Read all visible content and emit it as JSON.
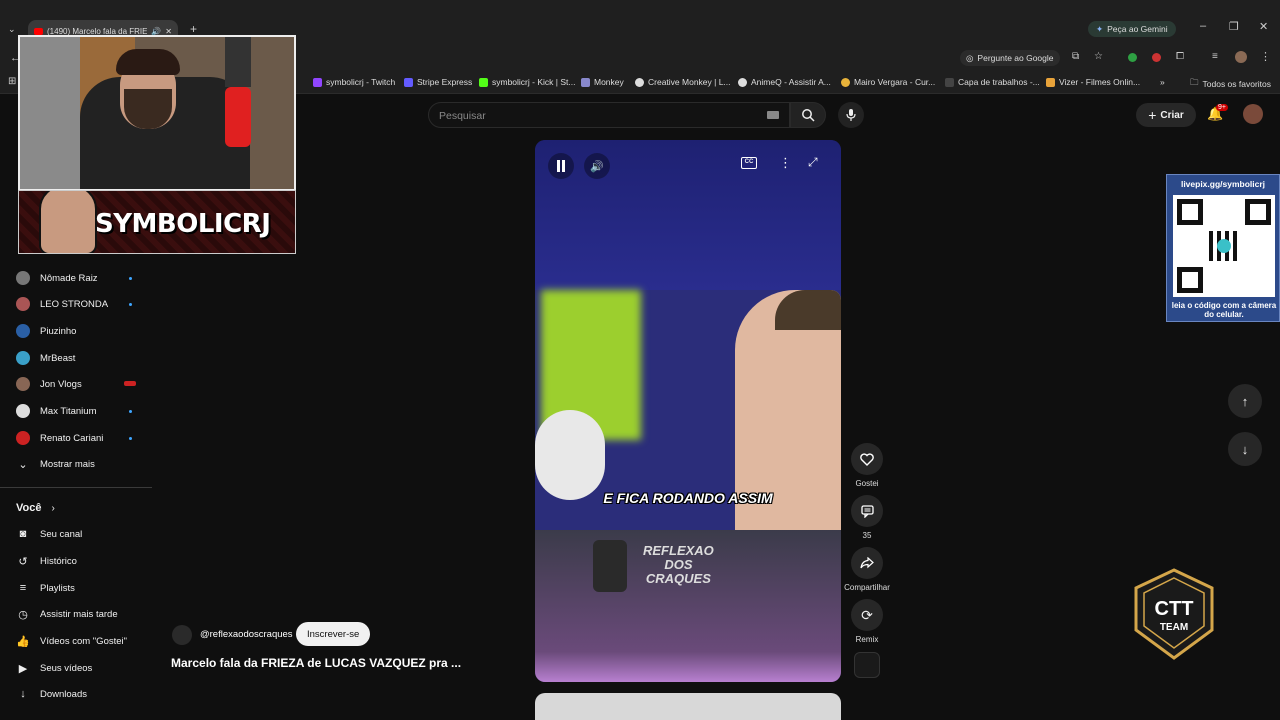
{
  "browser": {
    "tab_title": "(1490) Marcelo fala da FRIE",
    "gemini_label": "Peça ao Gemini",
    "ask_google_label": "Pergunte ao Google",
    "bookmarks": [
      {
        "label": "symbolicrj - Twitch",
        "color": "#9146ff"
      },
      {
        "label": "Stripe Express",
        "color": "#635bff"
      },
      {
        "label": "symbolicrj - Kick | St...",
        "color": "#53fc18"
      },
      {
        "label": "Monkey",
        "color": "#88c"
      },
      {
        "label": "Creative Monkey | L...",
        "color": "#ddd"
      },
      {
        "label": "AnimeQ - Assistir A...",
        "color": "#ddd"
      },
      {
        "label": "Mairo Vergara - Cur...",
        "color": "#e8b33a"
      },
      {
        "label": "Capa de trabalhos -...",
        "color": "#444"
      },
      {
        "label": "Vizer - Filmes Onlin...",
        "color": "#e8a33a"
      }
    ],
    "all_favorites_label": "Todos os favoritos"
  },
  "header": {
    "search_placeholder": "Pesquisar",
    "create_label": "Criar",
    "notification_badge": "9+"
  },
  "overlay": {
    "streamer_name": "SYMBOLICRJ",
    "qr_url": "livepix.gg/symbolicrj",
    "qr_caption": "leia o código com a câmera do celular.",
    "team_logo": "CTT",
    "team_sub": "TEAM"
  },
  "sidebar": {
    "subscriptions": [
      {
        "label": "Nômade Raiz",
        "color": "#777",
        "dot": true
      },
      {
        "label": "LEO STRONDA",
        "color": "#a55",
        "dot": true
      },
      {
        "label": "Piuzinho",
        "color": "#2a5fa5",
        "dot": false
      },
      {
        "label": "MrBeast",
        "color": "#3aa0c8",
        "dot": false
      },
      {
        "label": "Jon Vlogs",
        "color": "#886655",
        "dot": false
      },
      {
        "label": "Max Titanium",
        "color": "#ddd",
        "dot": true
      },
      {
        "label": "Renato Cariani",
        "color": "#c22",
        "dot": true
      }
    ],
    "show_more": "Mostrar mais",
    "you_section": "Você",
    "you_items": [
      {
        "label": "Seu canal",
        "icon": "channel-icon",
        "glyph": "◙"
      },
      {
        "label": "Histórico",
        "icon": "history-icon",
        "glyph": "↺"
      },
      {
        "label": "Playlists",
        "icon": "playlists-icon",
        "glyph": "≡"
      },
      {
        "label": "Assistir mais tarde",
        "icon": "watch-later-icon",
        "glyph": "◷"
      },
      {
        "label": "Vídeos com \"Gostei\"",
        "icon": "thumbs-up-icon",
        "glyph": "👍"
      },
      {
        "label": "Seus vídeos",
        "icon": "your-videos-icon",
        "glyph": "▶"
      },
      {
        "label": "Downloads",
        "icon": "download-icon",
        "glyph": "↓"
      }
    ]
  },
  "short": {
    "caption": "E FICA RODANDO ASSIM",
    "watermark_lines": [
      "REFLEXAO",
      "DOS",
      "CRAQUES"
    ],
    "channel": "@reflexaodoscraques",
    "subscribe_label": "Inscrever-se",
    "title": "Marcelo fala da FRIEZA de LUCAS VAZQUEZ pra ...",
    "actions": {
      "like_label": "Gostei",
      "comments_count": "35",
      "share_label": "Compartilhar",
      "remix_label": "Remix"
    }
  }
}
